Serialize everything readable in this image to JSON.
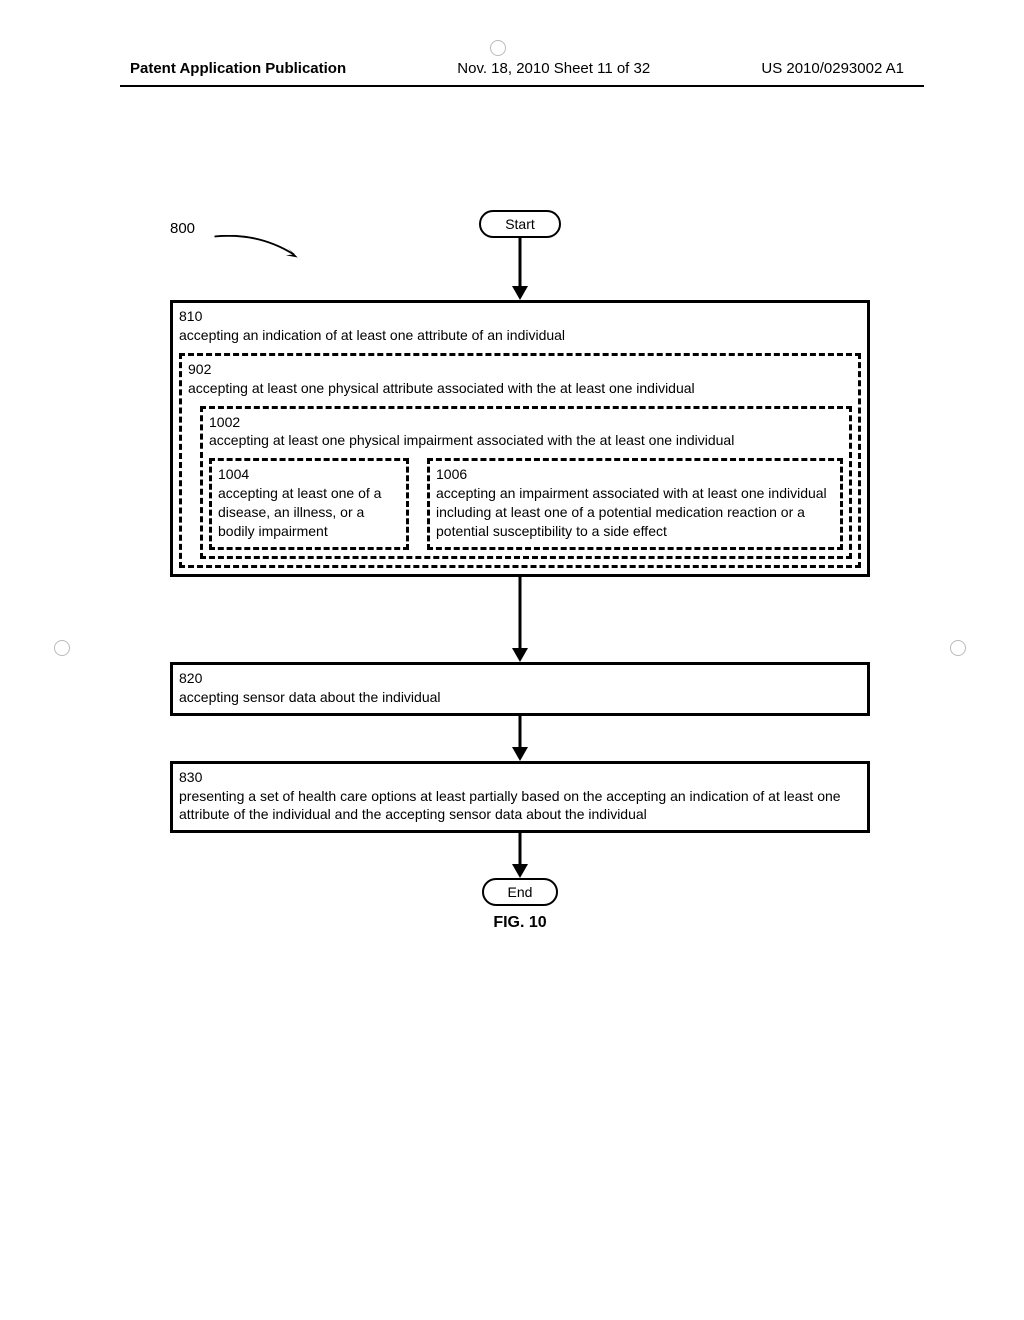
{
  "header": {
    "left": "Patent Application Publication",
    "mid": "Nov. 18, 2010  Sheet 11 of 32",
    "right": "US 2010/0293002 A1"
  },
  "flowchart": {
    "ref": "800",
    "start": "Start",
    "end": "End",
    "figure_label": "FIG. 10",
    "box810": {
      "num": "810",
      "text": "accepting an indication of at least one attribute of an individual"
    },
    "box902": {
      "num": "902",
      "text": "accepting at least one physical attribute associated with the at least one individual"
    },
    "box1002": {
      "num": "1002",
      "text": "accepting at least one physical impairment associated with the at least one individual"
    },
    "box1004": {
      "num": "1004",
      "text": "accepting at least one of a disease, an illness, or a bodily impairment"
    },
    "box1006": {
      "num": "1006",
      "text": "accepting an impairment associated with at least one individual including at least one of a potential medication reaction or a potential susceptibility to a side effect"
    },
    "box820": {
      "num": "820",
      "text": "accepting sensor data about the individual"
    },
    "box830": {
      "num": "830",
      "text": "presenting a set of health care options at least partially based on the accepting an indication of at least one attribute of the individual and the accepting sensor data about the individual"
    }
  }
}
